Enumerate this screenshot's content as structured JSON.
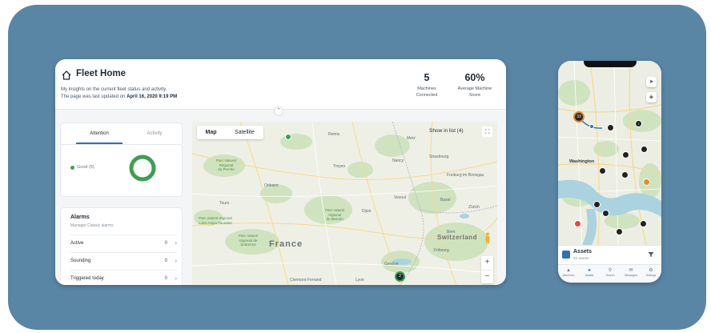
{
  "desktop": {
    "title": "Fleet Home",
    "subtitle_line1": "My insights on the current fleet status and activity.",
    "subtitle_line2_prefix": "The page was last updated on ",
    "subtitle_line2_date": "April 16, 2020 9:19 PM",
    "stats": [
      {
        "value": "5",
        "label_line1": "Machines",
        "label_line2": "Connected"
      },
      {
        "value": "60%",
        "label_line1": "Average Machine",
        "label_line2": "Score"
      }
    ],
    "tabs": {
      "attention": "Attention",
      "activity": "Activity"
    },
    "legend_good": "Good (5)",
    "status_colors": {
      "good": "#3d9f50",
      "accent": "#2f6fbf"
    },
    "alarms": {
      "title": "Alarms",
      "subtitle": "Manager Classic alarms",
      "rows": [
        {
          "label": "Active",
          "count": "0"
        },
        {
          "label": "Sounding",
          "count": "0"
        },
        {
          "label": "Triggered today",
          "count": "0"
        }
      ]
    },
    "map": {
      "toggle_map": "Map",
      "toggle_satellite": "Satellite",
      "show_in_list": "Show in list (4)",
      "zoom_in": "+",
      "zoom_out": "−",
      "cluster_count": "2",
      "labels": {
        "france": "France",
        "switzerland": "Switzerland",
        "strasbourg": "Strasbourg",
        "zurich": "Zürich",
        "geneva": "Genève",
        "lyon": "Lyon",
        "clermont": "Clermont-Ferrand",
        "troyes": "Troyes",
        "orleans": "Orléans",
        "tours": "Tours",
        "dijon": "Dijon",
        "reims": "Reims",
        "metz": "Metz",
        "nancy": "Nancy",
        "bern": "Bern",
        "basel": "Basel",
        "freiburg": "Freiburg im Breisgau",
        "vesoul": "Vesoul",
        "fribourg": "Fribourg",
        "park_perche": "Parc Naturel\nRégional\ndu Perche",
        "park_morvan": "Parc naturel\nrégional\ndu Morvan",
        "park_loire": "Parc naturel régional\nLoire-Anjou-Touraine",
        "park_brenne": "Parc naturel\nrégional de\nla Brenne"
      }
    }
  },
  "phone": {
    "map_label_city": "Washington",
    "cluster_count": "33",
    "assets_title": "Assets",
    "assets_count": "25 assets",
    "tabs": [
      "Machines",
      "Assets",
      "Search",
      "Messages",
      "Settings"
    ]
  }
}
